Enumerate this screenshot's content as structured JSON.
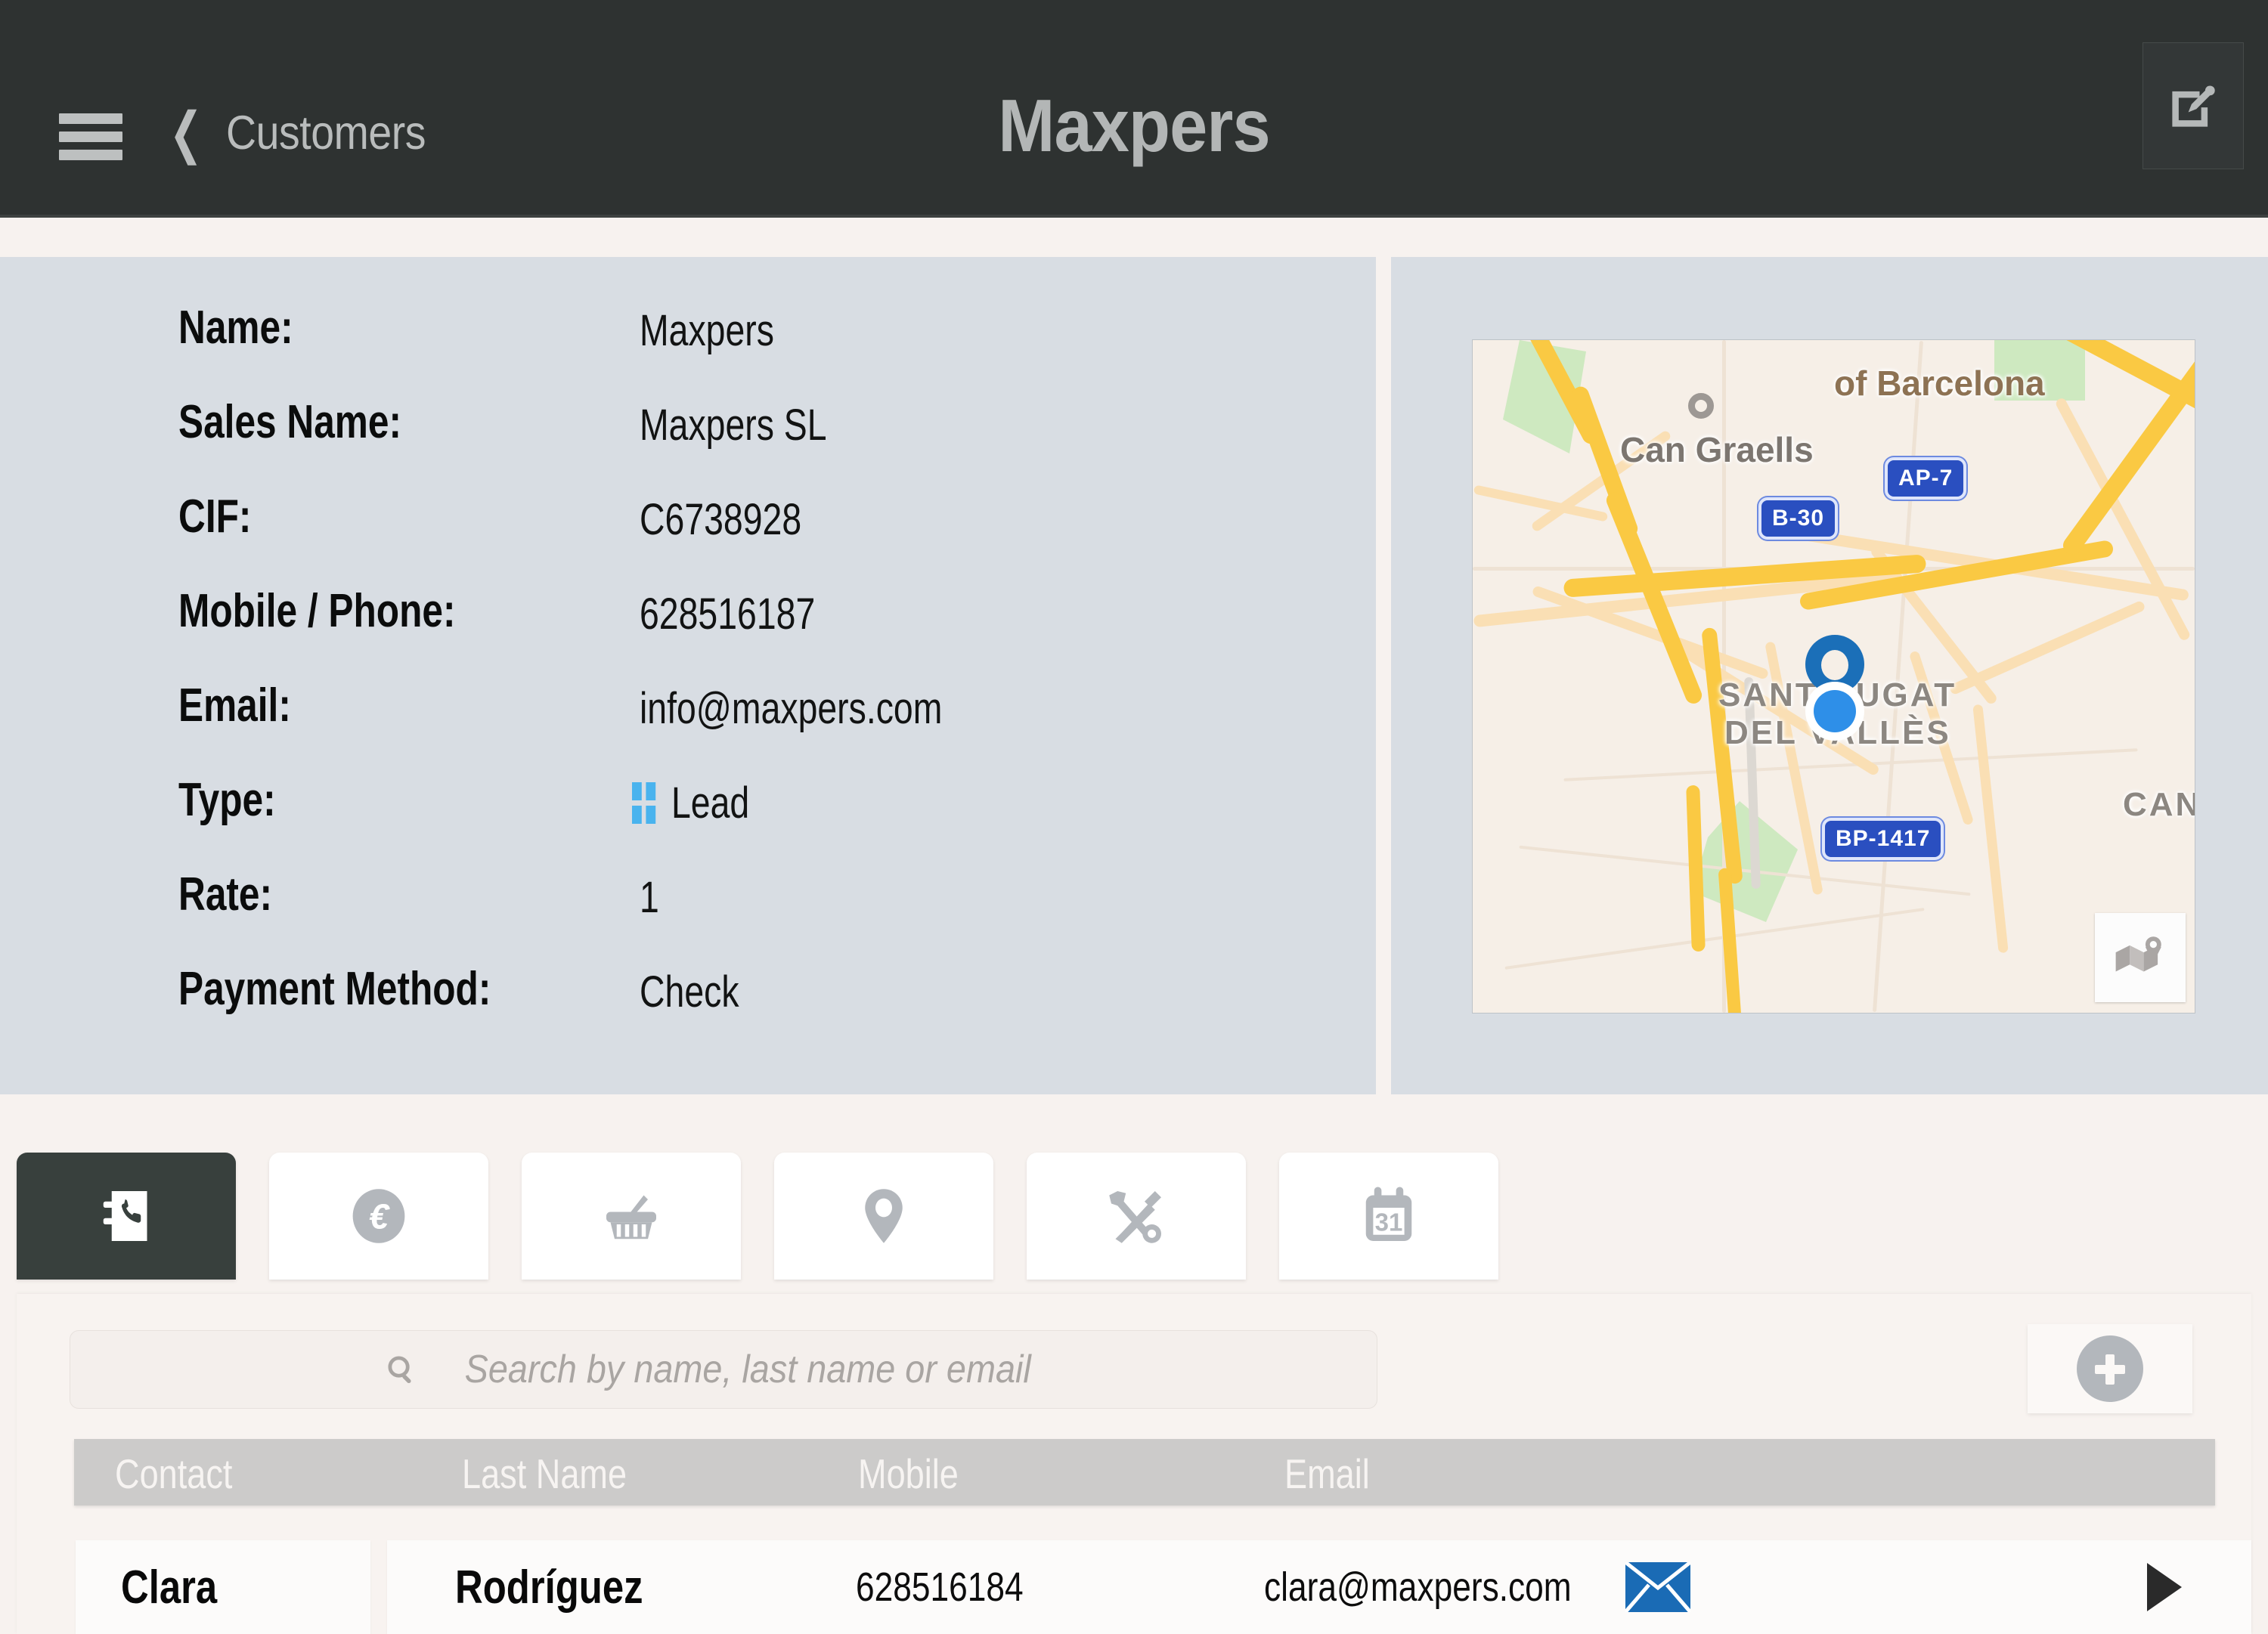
{
  "header": {
    "menu_icon": "hamburger-icon",
    "back_icon": "chevron-left-icon",
    "back_label": "Customers",
    "title": "Maxpers",
    "edit_icon": "edit-square-pencil-icon"
  },
  "detail": {
    "fields": [
      {
        "label": "Name:",
        "value": "Maxpers"
      },
      {
        "label": "Sales Name:",
        "value": "Maxpers SL"
      },
      {
        "label": "CIF:",
        "value": "C6738928"
      },
      {
        "label": "Mobile / Phone:",
        "value": "628516187"
      },
      {
        "label": "Email:",
        "value": "info@maxpers.com"
      },
      {
        "label": "Type:",
        "value": "Lead"
      },
      {
        "label": "Rate:",
        "value": "1"
      },
      {
        "label": "Payment Method:",
        "value": "Check"
      }
    ],
    "type_swatch_color": "#49b3ee"
  },
  "map": {
    "labels": [
      {
        "text": "of Barcelona",
        "kind": "brown"
      },
      {
        "text": "Can Graells",
        "kind": "place"
      },
      {
        "text": "SANT CUGAT",
        "kind": "city"
      },
      {
        "text": "DEL VALLÈS",
        "kind": "city"
      },
      {
        "text": "CAN C",
        "kind": "place"
      }
    ],
    "shields": [
      "AP-7",
      "B-30",
      "BP-1417"
    ],
    "pin_icon": "map-pin-icon",
    "layers_button_icon": "map-layers-icon"
  },
  "tabs": [
    {
      "icon": "contacts-book-phone-icon",
      "active": true
    },
    {
      "icon": "euro-coin-icon",
      "active": false
    },
    {
      "icon": "shopping-basket-icon",
      "active": false
    },
    {
      "icon": "location-pin-icon",
      "active": false
    },
    {
      "icon": "tools-wrench-hammer-icon",
      "active": false
    },
    {
      "icon": "calendar-31-icon",
      "active": false
    }
  ],
  "list": {
    "search": {
      "icon": "search-icon",
      "placeholder": "Search by name, last name or email",
      "value": ""
    },
    "add_button": {
      "icon": "plus-circle-icon",
      "label": ""
    },
    "columns": [
      "Contact",
      "Last Name",
      "Mobile",
      "Email"
    ],
    "rows": [
      {
        "contact": "Clara",
        "last_name": "Rodríguez",
        "mobile": "628516184",
        "email": "clara@maxpers.com",
        "mail_icon": "envelope-icon",
        "detail_icon": "chevron-right-icon"
      }
    ]
  },
  "colors": {
    "topbar": "#2e3231",
    "panel": "#d8dde3",
    "page_bg": "#f7f2ef",
    "accent_blue": "#49b3ee",
    "mail_blue": "#1a6bb5"
  }
}
